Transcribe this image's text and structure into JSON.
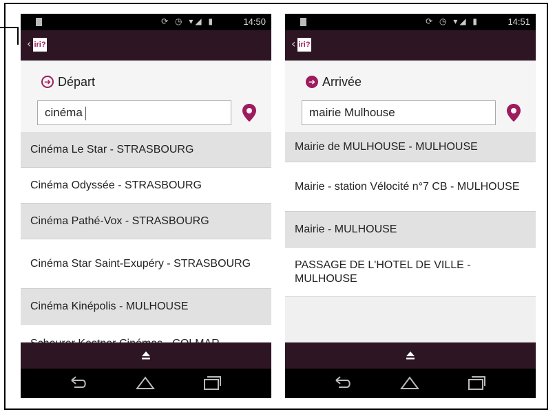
{
  "screens": [
    {
      "status": {
        "time": "14:50",
        "icons": "⟳ ◷ ▾◢ ▮"
      },
      "app": {
        "logo": "iri?",
        "back": "‹"
      },
      "heading": {
        "label": "Départ",
        "icon": "arrow-right-outline-icon"
      },
      "search": {
        "value": "cinéma"
      },
      "results": [
        "Cinéma Le Star - STRASBOURG",
        "Cinéma Odyssée - STRASBOURG",
        "Cinéma Pathé-Vox - STRASBOURG",
        "Cinéma Star Saint-Exupéry - STRASBOURG",
        "Cinéma Kinépolis - MULHOUSE",
        "Scheurer Kestner Cinémas - COLMAR"
      ]
    },
    {
      "status": {
        "time": "14:51",
        "icons": "⟳ ◷ ▾◢ ▮"
      },
      "app": {
        "logo": "iri?",
        "back": "‹"
      },
      "heading": {
        "label": "Arrivée",
        "icon": "arrow-right-filled-icon"
      },
      "search": {
        "value": "mairie Mulhouse"
      },
      "results": [
        "Mairie de MULHOUSE - MULHOUSE",
        "Mairie - station Vélocité n°7 CB - MULHOUSE",
        "Mairie - MULHOUSE",
        "PASSAGE DE L'HOTEL DE VILLE - MULHOUSE"
      ]
    }
  ],
  "colors": {
    "accent": "#9e1b5d",
    "appbar": "#2d1524",
    "row_grey": "#e1e1e1",
    "row_white": "#ffffff"
  }
}
